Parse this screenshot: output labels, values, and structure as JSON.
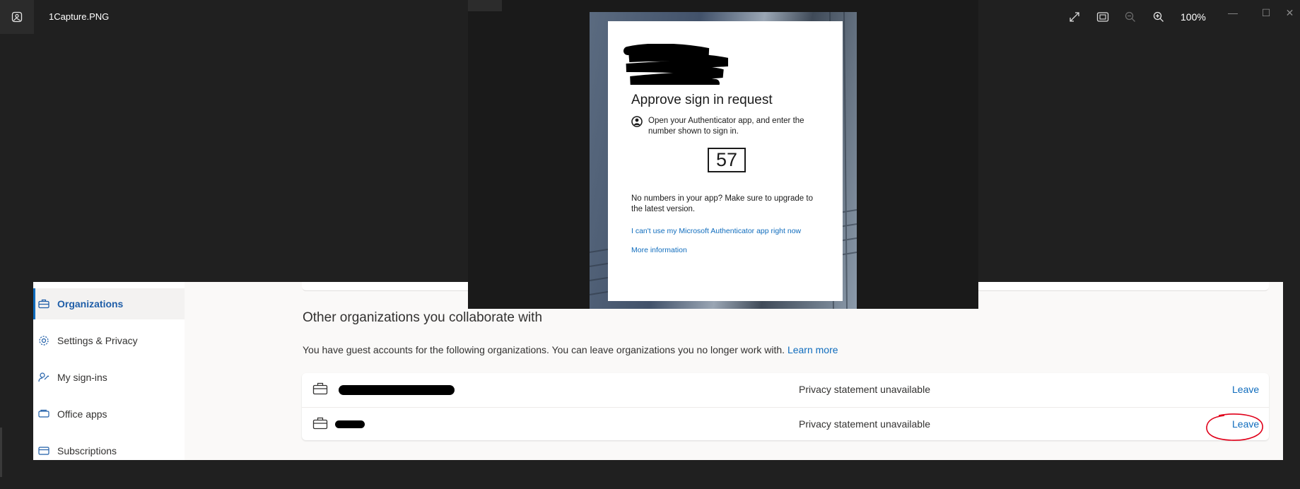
{
  "viewer": {
    "file_title": "1Capture.PNG",
    "zoom_level": "100%",
    "icons": [
      "photos-app-icon",
      "expand-icon",
      "fit-to-window-icon",
      "zoom-out-icon",
      "zoom-in-icon"
    ],
    "window_controls": {
      "minimize": "—",
      "maximize": "☐",
      "close": "✕"
    }
  },
  "login_dialog": {
    "title": "Approve sign in request",
    "instruction": "Open your Authenticator app, and enter the number shown to sign in.",
    "number": "57",
    "note": "No numbers in your app? Make sure to upgrade to the latest version.",
    "link_cant_use": "I can't use my Microsoft Authenticator app right now",
    "link_more_info": "More information"
  },
  "page": {
    "sidebar": {
      "items": [
        {
          "label": "Organizations",
          "icon": "briefcase-icon",
          "active": true
        },
        {
          "label": "Settings & Privacy",
          "icon": "gear-icon",
          "active": false
        },
        {
          "label": "My sign-ins",
          "icon": "person-key-icon",
          "active": false
        },
        {
          "label": "Office apps",
          "icon": "office-apps-icon",
          "active": false
        },
        {
          "label": "Subscriptions",
          "icon": "card-icon",
          "active": false
        }
      ]
    },
    "section": {
      "title": "Other organizations you collaborate with",
      "description": "You have guest accounts for the following organizations. You can leave organizations you no longer work with.",
      "learn_more": "Learn more"
    },
    "organizations": [
      {
        "privacy": "Privacy statement unavailable",
        "action": "Leave"
      },
      {
        "privacy": "Privacy statement unavailable",
        "action": "Leave"
      }
    ]
  },
  "colors": {
    "accent": "#0f6cbd",
    "viewer_bg": "#202020",
    "annotation": "#e0001a"
  }
}
